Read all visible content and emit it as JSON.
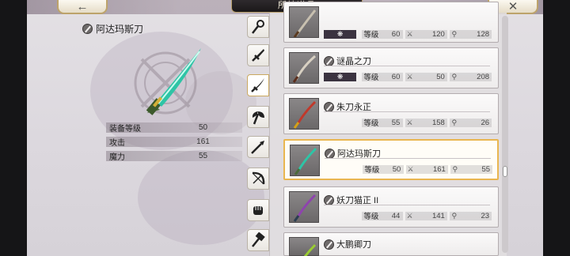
{
  "header": {
    "title": "所持道具",
    "back_icon": "back-arrow-icon",
    "close_icon": "close-x-icon"
  },
  "detail": {
    "name": "阿达玛斯刀",
    "stats": [
      {
        "label": "装备等级",
        "value": "50"
      },
      {
        "label": "攻击",
        "value": "161"
      },
      {
        "label": "魔力",
        "value": "55"
      }
    ]
  },
  "tabs": [
    {
      "icon": "staff-icon"
    },
    {
      "icon": "dagger-icon"
    },
    {
      "icon": "katana-icon"
    },
    {
      "icon": "axe-icon"
    },
    {
      "icon": "spear-icon"
    },
    {
      "icon": "bow-icon"
    },
    {
      "icon": "fist-icon"
    },
    {
      "icon": "hammer-icon"
    }
  ],
  "item_list": {
    "level_label": "等级",
    "skill_symbol": "❋",
    "items": [
      {
        "name": "",
        "level": "60",
        "atk": "120",
        "mag": "128",
        "has_skill": true,
        "blade_color": "#c8c0b0"
      },
      {
        "name": "谜晶之刀",
        "level": "60",
        "atk": "50",
        "mag": "208",
        "has_skill": true,
        "blade_color": "#d8d0c2"
      },
      {
        "name": "朱刀永正",
        "level": "55",
        "atk": "158",
        "mag": "26",
        "has_skill": false,
        "blade_color": "#c0392b"
      },
      {
        "name": "阿达玛斯刀",
        "level": "50",
        "atk": "161",
        "mag": "55",
        "has_skill": false,
        "blade_color": "#2ec4a6"
      },
      {
        "name": "妖刀猫正 II",
        "level": "44",
        "atk": "141",
        "mag": "23",
        "has_skill": false,
        "blade_color": "#8e44ad"
      },
      {
        "name": "大鹏卿刀",
        "level": "",
        "atk": "",
        "mag": "",
        "has_skill": false,
        "blade_color": "#9acd32"
      }
    ]
  },
  "colors": {
    "selected_border": "#e9b650",
    "skill_block": "#3b3340",
    "accent_gold": "#bda36b"
  }
}
